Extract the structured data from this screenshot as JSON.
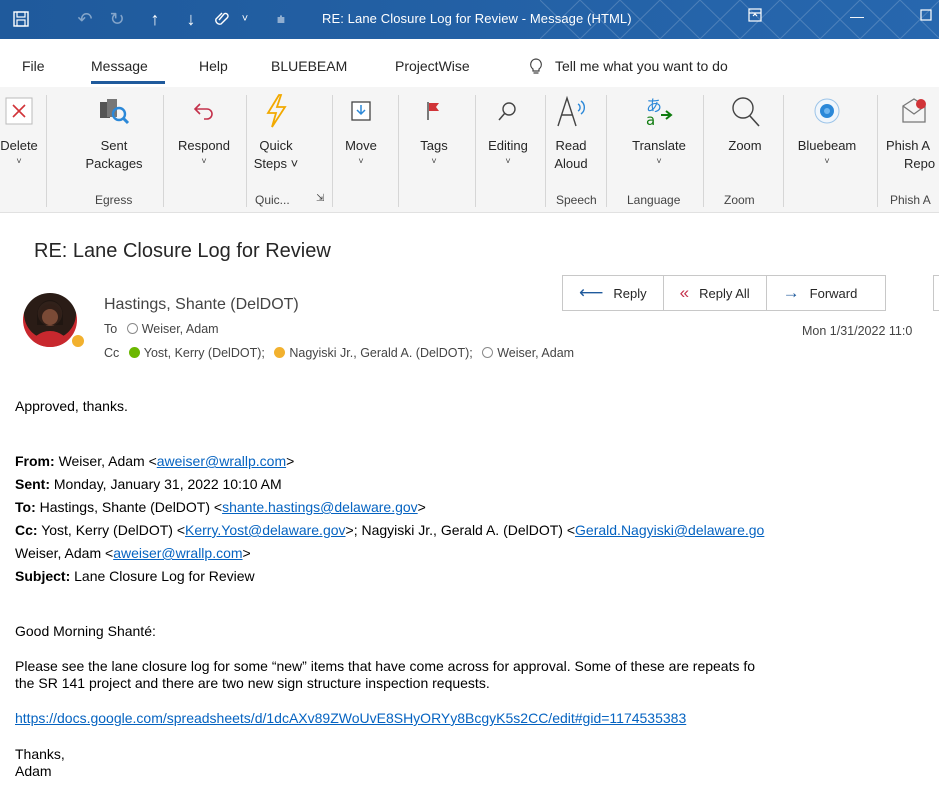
{
  "window": {
    "title": "RE: Lane Closure Log for Review  -  Message (HTML)",
    "quick_access_icons": [
      "save-icon",
      "undo-icon",
      "redo-icon",
      "up-arrow-icon",
      "down-arrow-icon",
      "attach-icon",
      "customize-icon"
    ]
  },
  "menu": {
    "tabs": [
      "File",
      "Message",
      "Help",
      "BLUEBEAM",
      "ProjectWise"
    ],
    "active": "Message",
    "tell_me": "Tell me what you want to do"
  },
  "ribbon": {
    "buttons": {
      "delete": "Delete",
      "sent_packages_1": "Sent",
      "sent_packages_2": "Packages",
      "respond": "Respond",
      "quick_steps_1": "Quick",
      "quick_steps_2": "Steps ˅",
      "move": "Move",
      "tags": "Tags",
      "editing": "Editing",
      "read_aloud_1": "Read",
      "read_aloud_2": "Aloud",
      "translate": "Translate",
      "zoom": "Zoom",
      "bluebeam": "Bluebeam",
      "phish_1": "Phish A",
      "phish_2": "Repo"
    },
    "groups": {
      "egress": "Egress",
      "quick": "Quic...",
      "speech": "Speech",
      "language": "Language",
      "zoom": "Zoom",
      "phish": "Phish A"
    }
  },
  "message": {
    "subject": "RE: Lane Closure Log for Review",
    "sender": "Hastings, Shante (DelDOT)",
    "to_label": "To",
    "to": "Weiser, Adam",
    "cc_label": "Cc",
    "cc_1": "Yost, Kerry (DelDOT);",
    "cc_2": "Nagyiski Jr., Gerald A. (DelDOT);",
    "cc_3": "Weiser, Adam",
    "date": "Mon 1/31/2022 11:0",
    "actions": {
      "reply": "Reply",
      "reply_all": "Reply All",
      "forward": "Forward"
    }
  },
  "body": {
    "reply_text": "Approved, thanks.",
    "from_label": "From:",
    "from_name": "Weiser, Adam <",
    "from_email": "aweiser@wrallp.com",
    "from_close": ">",
    "sent_label": "Sent:",
    "sent_value": "Monday, January 31, 2022 10:10 AM",
    "to_label": "To:",
    "to_name": "Hastings, Shante (DelDOT) <",
    "to_email": "shante.hastings@delaware.gov",
    "to_close": ">",
    "cc_label": "Cc:",
    "cc_name_1": "Yost, Kerry (DelDOT) <",
    "cc_email_1": "Kerry.Yost@delaware.gov",
    "cc_mid": ">; Nagyiski Jr., Gerald A. (DelDOT) <",
    "cc_email_2": "Gerald.Nagyiski@delaware.go",
    "cc_line2_name": "Weiser, Adam <",
    "cc_line2_email": "aweiser@wrallp.com",
    "cc_line2_close": ">",
    "subject_label": "Subject:",
    "subject_value": "Lane Closure Log for Review",
    "greeting": "Good Morning Shanté:",
    "para_line1": "Please see the lane closure log for some “new” items that have come across for approval. Some of these are repeats fo",
    "para_line2": "the SR 141 project and there are two new sign structure inspection requests.",
    "link": "https://docs.google.com/spreadsheets/d/1dcAXv89ZWoUvE8SHyORYy8BcgyK5s2CC/edit#gid=1174535383",
    "signoff": "Thanks,",
    "signature": "Adam"
  }
}
